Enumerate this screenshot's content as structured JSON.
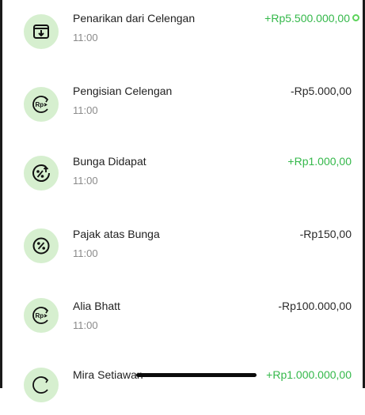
{
  "transactions": [
    {
      "title": "Penarikan dari Celengan",
      "time": "11:00",
      "amount": "+Rp5.500.000,00",
      "positive": true,
      "icon": "withdraw-tray-icon"
    },
    {
      "title": "Pengisian Celengan",
      "time": "11:00",
      "amount": "-Rp5.000,00",
      "positive": false,
      "icon": "rp-transfer-icon"
    },
    {
      "title": "Bunga Didapat",
      "time": "11:00",
      "amount": "+Rp1.000,00",
      "positive": true,
      "icon": "percent-up-icon"
    },
    {
      "title": "Pajak atas Bunga",
      "time": "11:00",
      "amount": "-Rp150,00",
      "positive": false,
      "icon": "percent-icon"
    },
    {
      "title": "Alia Bhatt",
      "time": "11:00",
      "amount": "-Rp100.000,00",
      "positive": false,
      "icon": "rp-transfer-icon"
    },
    {
      "title": "Mira Setiawan",
      "time": "",
      "amount": "+Rp1.000.000,00",
      "positive": true,
      "icon": "rp-transfer-icon"
    }
  ],
  "colors": {
    "positive": "#34b84a",
    "negative": "#2a2a2a",
    "icon_background": "#d6efcf"
  }
}
